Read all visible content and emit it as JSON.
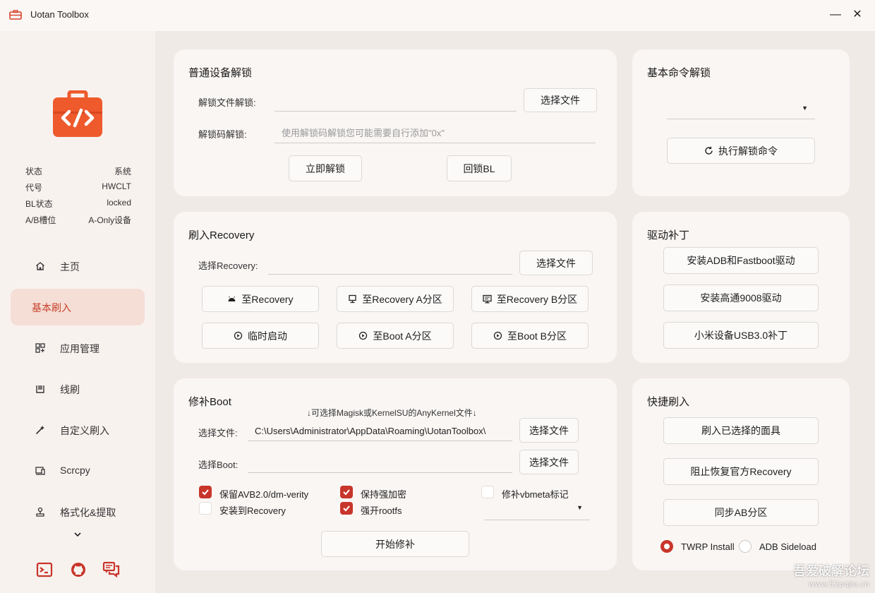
{
  "app": {
    "title": "Uotan Toolbox",
    "accent": "#c8352b",
    "logo_color": "#ee5a2c"
  },
  "window": {
    "minimize": "—",
    "close": "✕"
  },
  "status": [
    {
      "key": "状态",
      "value": "系统"
    },
    {
      "key": "代号",
      "value": "HWCLT"
    },
    {
      "key": "BL状态",
      "value": "locked"
    },
    {
      "key": "A/B槽位",
      "value": "A-Only设备"
    }
  ],
  "nav": {
    "items": [
      {
        "label": "主页",
        "icon": "home-icon"
      },
      {
        "label": "基本刷入",
        "icon": "flash-icon",
        "active": true
      },
      {
        "label": "应用管理",
        "icon": "apps-icon"
      },
      {
        "label": "线刷",
        "icon": "line-flash-icon"
      },
      {
        "label": "自定义刷入",
        "icon": "custom-flash-icon"
      },
      {
        "label": "Scrcpy",
        "icon": "screen-mirror-icon"
      },
      {
        "label": "格式化&提取",
        "icon": "format-icon"
      }
    ],
    "more": "chevron-down-icon",
    "footer_icons": [
      "terminal-icon",
      "github-icon",
      "chat-icon"
    ]
  },
  "unlock": {
    "title": "普通设备解锁",
    "file_label": "解锁文件解锁:",
    "file_value": "",
    "choose_file": "选择文件",
    "code_label": "解锁码解锁:",
    "code_placeholder": "使用解锁码解锁您可能需要自行添加\"0x\"",
    "unlock_now": "立即解锁",
    "relock": "回锁BL"
  },
  "cmd_unlock": {
    "title": "基本命令解锁",
    "selected": "",
    "execute": "执行解锁命令"
  },
  "recovery": {
    "title": "刷入Recovery",
    "select_label": "选择Recovery:",
    "select_value": "",
    "choose_file": "选择文件",
    "to_recovery": "至Recovery",
    "to_recovery_a": "至Recovery A分区",
    "to_recovery_b": "至Recovery B分区",
    "temp_boot": "临时启动",
    "to_boot_a": "至Boot A分区",
    "to_boot_b": "至Boot B分区"
  },
  "driver": {
    "title": "驱动补丁",
    "install_adb": "安装ADB和Fastboot驱动",
    "install_qc": "安装高通9008驱动",
    "xiaomi_usb": "小米设备USB3.0补丁"
  },
  "patch_boot": {
    "title": "修补Boot",
    "hint": "↓可选择Magisk或KernelSU的AnyKernel文件↓",
    "file_label": "选择文件:",
    "file_value": "C:\\Users\\Administrator\\AppData\\Roaming\\UotanToolbox\\",
    "choose_file": "选择文件",
    "boot_label": "选择Boot:",
    "boot_value": "",
    "choose_boot": "选择文件",
    "options": {
      "keep_avb": {
        "label": "保留AVB2.0/dm-verity",
        "checked": true
      },
      "keep_encrypt": {
        "label": "保持强加密",
        "checked": true
      },
      "patch_vbmeta": {
        "label": "修补vbmeta标记",
        "checked": false
      },
      "install_recovery": {
        "label": "安装到Recovery",
        "checked": false
      },
      "force_rootfs": {
        "label": "强开rootfs",
        "checked": true
      }
    },
    "arch_selected": "",
    "start": "开始修补"
  },
  "quick_flash": {
    "title": "快捷刷入",
    "flash_selected": "刷入已选择的面具",
    "prevent_restore": "阻止恢复官方Recovery",
    "sync_ab": "同步AB分区",
    "mode_twrp": {
      "label": "TWRP Install",
      "selected": true
    },
    "mode_adb": {
      "label": "ADB Sideload",
      "selected": false
    }
  },
  "watermark": {
    "line1": "吾爱破解论坛",
    "line2": "www.52pojie.cn"
  }
}
